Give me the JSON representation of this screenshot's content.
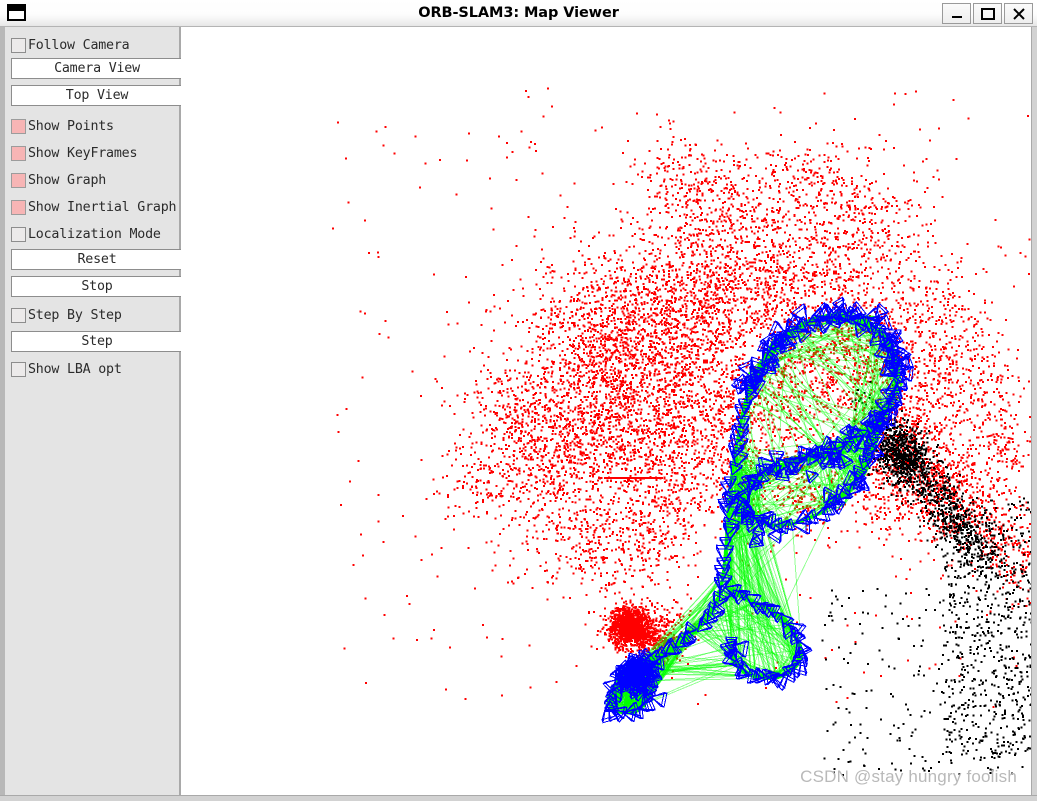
{
  "window": {
    "title": "ORB-SLAM3: Map Viewer",
    "icon": "window-icon",
    "controls": {
      "minimize": "minimize-icon",
      "maximize": "maximize-icon",
      "close": "close-icon"
    }
  },
  "sidebar": {
    "items": [
      {
        "type": "checkbox",
        "label": "Follow Camera",
        "checked": false,
        "name": "follow-camera"
      },
      {
        "type": "button",
        "label": "Camera View",
        "name": "camera-view"
      },
      {
        "type": "button",
        "label": "Top View",
        "name": "top-view"
      },
      {
        "type": "checkbox",
        "label": "Show Points",
        "checked": true,
        "name": "show-points"
      },
      {
        "type": "checkbox",
        "label": "Show KeyFrames",
        "checked": true,
        "name": "show-keyframes"
      },
      {
        "type": "checkbox",
        "label": "Show Graph",
        "checked": true,
        "name": "show-graph"
      },
      {
        "type": "checkbox",
        "label": "Show Inertial Graph",
        "checked": true,
        "name": "show-inertial-graph"
      },
      {
        "type": "checkbox",
        "label": "Localization Mode",
        "checked": false,
        "name": "localization-mode"
      },
      {
        "type": "button",
        "label": "Reset",
        "name": "reset"
      },
      {
        "type": "button",
        "label": "Stop",
        "name": "stop"
      },
      {
        "type": "checkbox",
        "label": "Step By Step",
        "checked": false,
        "name": "step-by-step"
      },
      {
        "type": "button",
        "label": "Step",
        "name": "step"
      },
      {
        "type": "checkbox",
        "label": "Show LBA opt",
        "checked": false,
        "name": "show-lba-opt"
      }
    ]
  },
  "viewport": {
    "watermark": "CSDN @stay hungry foolish",
    "background": "#ffffff",
    "colors": {
      "map_points": "#ff0000",
      "reference_points": "#000000",
      "keyframes": "#0000ff",
      "graph_edges": "#00ff00",
      "accent_checkbox": "#f7b5b5"
    }
  }
}
